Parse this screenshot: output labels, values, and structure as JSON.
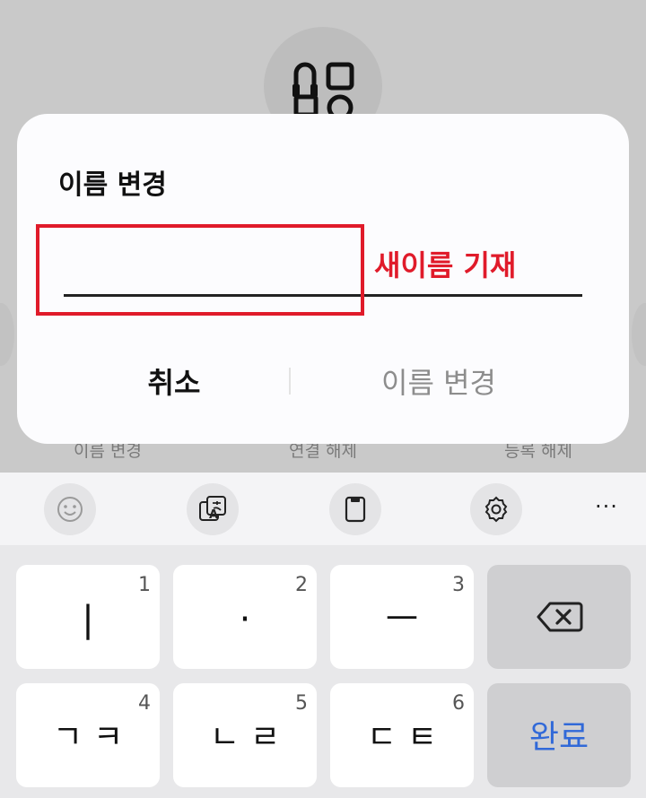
{
  "background": {
    "actions": [
      "이름 변경",
      "연결 해제",
      "등록 해제"
    ]
  },
  "dialog": {
    "title": "이름 변경",
    "input": {
      "value": "",
      "placeholder": ""
    },
    "annotation": "새이름 기재",
    "cancel_label": "취소",
    "confirm_label": "이름 변경"
  },
  "keyboard_toolbar": {
    "icons": [
      "emoji-icon",
      "translate-icon",
      "clipboard-icon",
      "settings-icon",
      "more-icon"
    ],
    "more_label": "···"
  },
  "keyboard": {
    "rows": [
      [
        {
          "num": "1",
          "label": "|"
        },
        {
          "num": "2",
          "label": "·"
        },
        {
          "num": "3",
          "label": "ㅡ"
        },
        {
          "num": "",
          "label": "backspace"
        }
      ],
      [
        {
          "num": "4",
          "label": "ㄱㅋ"
        },
        {
          "num": "5",
          "label": "ㄴㄹ"
        },
        {
          "num": "6",
          "label": "ㄷㅌ"
        },
        {
          "num": "",
          "label": "완료"
        }
      ]
    ]
  },
  "colors": {
    "annotation": "#e01b2a",
    "done": "#3169d8",
    "dim_background": "#c9c9c9"
  }
}
